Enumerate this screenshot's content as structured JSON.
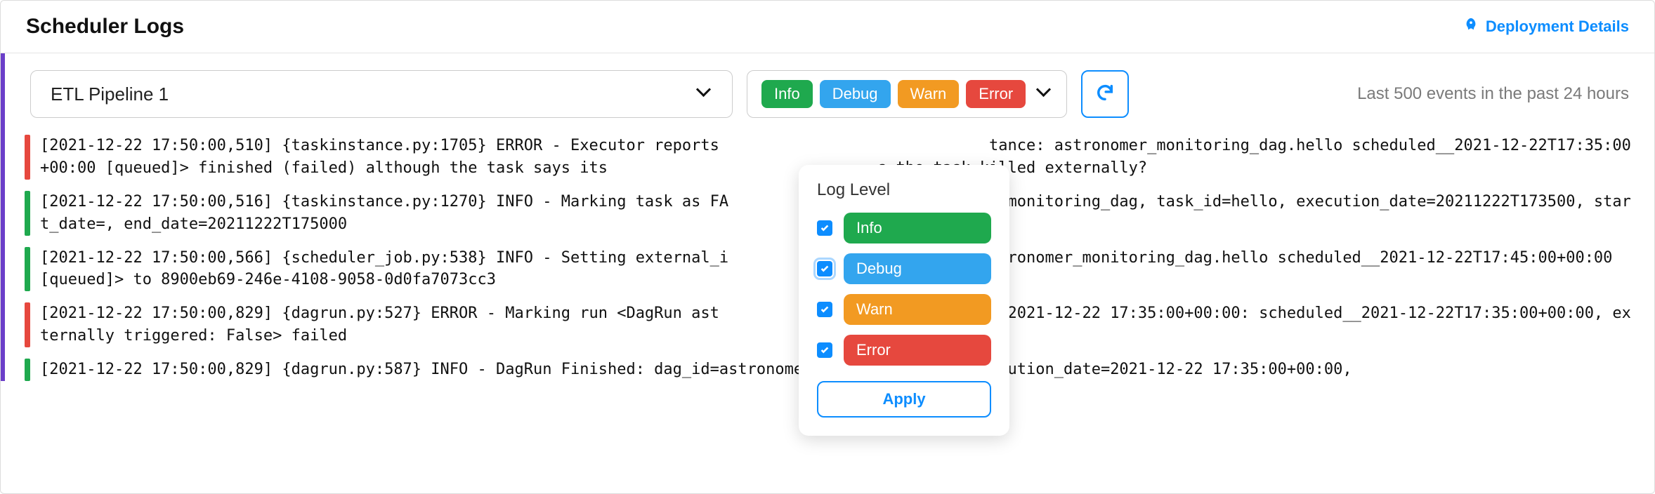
{
  "header": {
    "title": "Scheduler Logs",
    "deploy_link": "Deployment Details"
  },
  "toolbar": {
    "pipeline_selected": "ETL Pipeline 1",
    "levels": {
      "info": "Info",
      "debug": "Debug",
      "warn": "Warn",
      "error": "Error"
    },
    "hint": "Last 500 events in the past 24 hours"
  },
  "popover": {
    "title": "Log Level",
    "info": "Info",
    "debug": "Debug",
    "warn": "Warn",
    "error": "Error",
    "apply": "Apply"
  },
  "logs": [
    {
      "level": "error",
      "text": "[2021-12-22 17:50:00,510] {taskinstance.py:1705} ERROR - Executor reports                             tance: astronomer_monitoring_dag.hello scheduled__2021-12-22T17:35:00+00:00 [queued]> finished (failed) although the task says its                             s the task killed externally?"
    },
    {
      "level": "info",
      "text": "[2021-12-22 17:50:00,516] {taskinstance.py:1270} INFO - Marking task as FA                            r_monitoring_dag, task_id=hello, execution_date=20211222T173500, start_date=, end_date=20211222T175000"
    },
    {
      "level": "info",
      "text": "[2021-12-22 17:50:00,566] {scheduler_job.py:538} INFO - Setting external_i                            stronomer_monitoring_dag.hello scheduled__2021-12-22T17:45:00+00:00 [queued]> to 8900eb69-246e-4108-9058-0d0fa7073cc3"
    },
    {
      "level": "error",
      "text": "[2021-12-22 17:50:00,829] {dagrun.py:527} ERROR - Marking run <DagRun ast                             @ 2021-12-22 17:35:00+00:00: scheduled__2021-12-22T17:35:00+00:00, externally triggered: False> failed"
    },
    {
      "level": "info",
      "text": "[2021-12-22 17:50:00,829] {dagrun.py:587} INFO - DagRun Finished: dag_id=astronomer_monitoring_dag, execution_date=2021-12-22 17:35:00+00:00,"
    }
  ]
}
